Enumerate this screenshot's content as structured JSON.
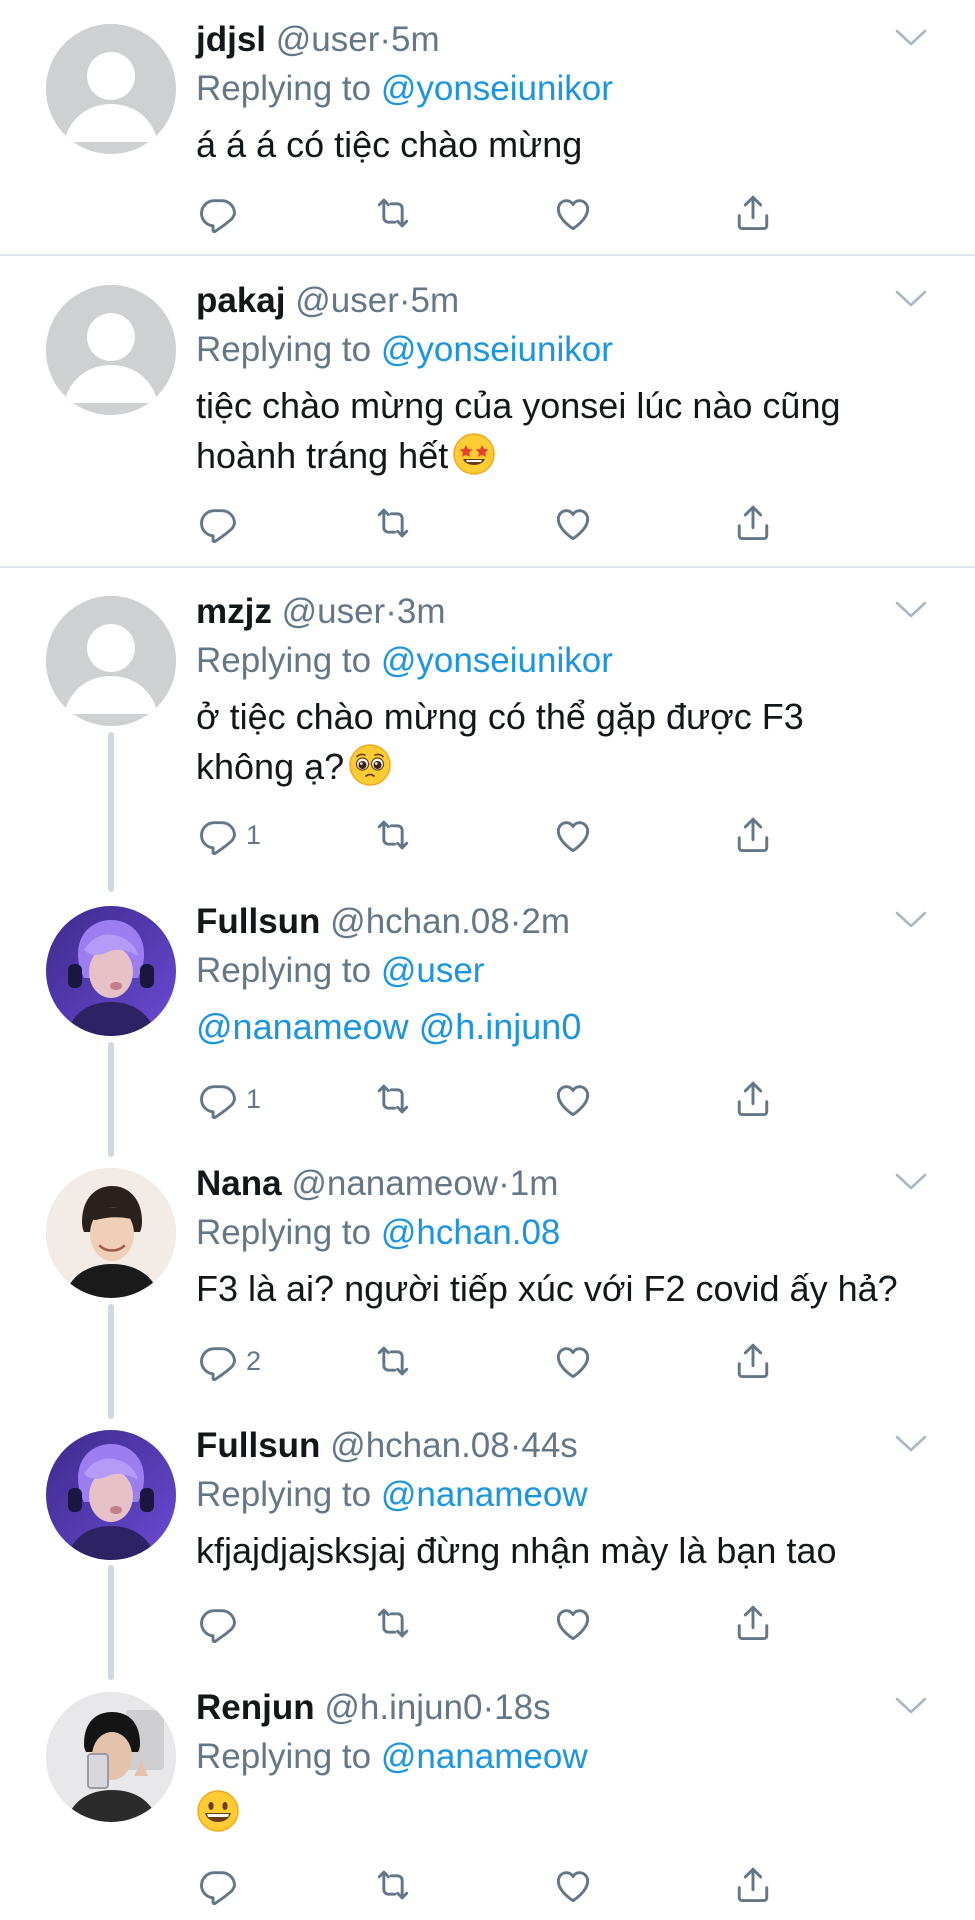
{
  "tweets": [
    {
      "name": "jdjsl",
      "handle": "@user",
      "time": "5m",
      "replying_label": "Replying to",
      "replying_to": "@yonseiunikor",
      "text": "á á á có tiệc chào mừng",
      "reply_count": ""
    },
    {
      "name": "pakaj",
      "handle": "@user",
      "time": "5m",
      "replying_label": "Replying to",
      "replying_to": "@yonseiunikor",
      "text_line1": "tiệc chào mừng của yonsei lúc nào cũng",
      "text_line2": "hoành tráng hết",
      "emoji": "star-struck-emoji",
      "reply_count": ""
    },
    {
      "name": "mzjz",
      "handle": "@user",
      "time": "3m",
      "replying_label": "Replying to",
      "replying_to": "@yonseiunikor",
      "text_line1": "ở tiệc chào mừng có thể gặp được F3",
      "text_line2": "không ạ?",
      "emoji": "pleading-face-emoji",
      "reply_count": "1"
    },
    {
      "name": "Fullsun",
      "handle": "@hchan.08",
      "time": "2m",
      "replying_label": "Replying to",
      "replying_to": "@user",
      "mention1": "@nanameow",
      "mention2": "@h.injun0",
      "reply_count": "1"
    },
    {
      "name": "Nana",
      "handle": "@nanameow",
      "time": "1m",
      "replying_label": "Replying to",
      "replying_to": "@hchan.08",
      "text": "F3 là ai? người tiếp xúc với F2 covid ấy hả?",
      "reply_count": "2"
    },
    {
      "name": "Fullsun",
      "handle": "@hchan.08",
      "time": "44s",
      "replying_label": "Replying to",
      "replying_to": "@nanameow",
      "text": "kfjajdjajsksjaj đừng nhận mày là bạn tao",
      "reply_count": ""
    },
    {
      "name": "Renjun",
      "handle": "@h.injun0",
      "time": "18s",
      "replying_label": "Replying to",
      "replying_to": "@nanameow",
      "emoji": "grinning-face-emoji",
      "reply_count": ""
    }
  ],
  "separator": "·",
  "icons": [
    "reply-icon",
    "retweet-icon",
    "like-icon",
    "share-icon",
    "chevron-down-icon",
    "default-avatar-icon"
  ],
  "colors": {
    "link": "#1b95e0",
    "secondary": "#657786",
    "divider": "#e1e8ed",
    "thread": "#cfd9de"
  }
}
